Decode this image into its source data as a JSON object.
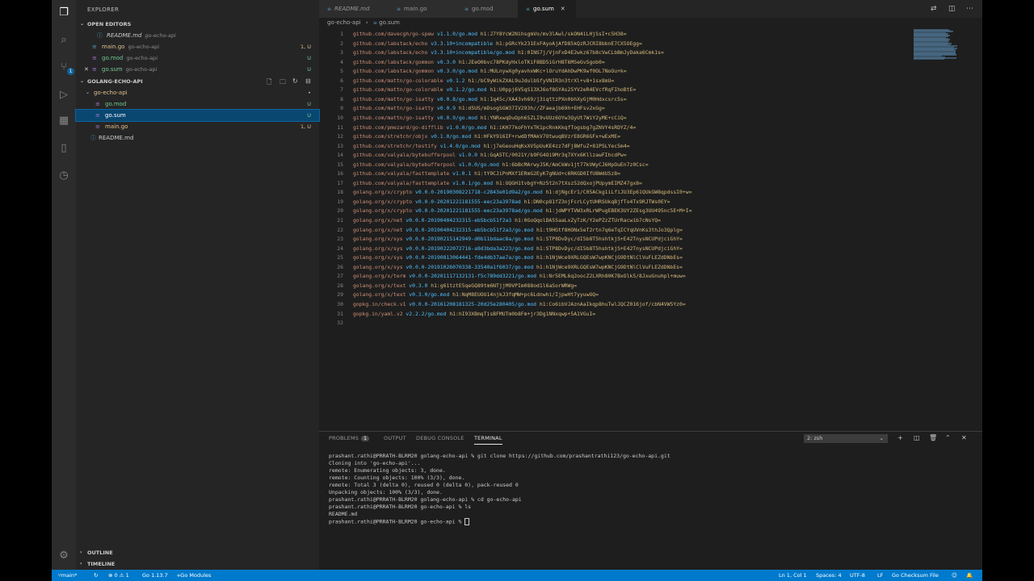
{
  "colors": {
    "accent": "#007acc",
    "modified": "#e2c08d",
    "untracked": "#73c991"
  },
  "activity": [
    "files-icon",
    "search-icon",
    "source-control-icon",
    "run-debug-icon",
    "extensions-icon",
    "bookmark-icon",
    "git-graph-icon",
    "settings-icon"
  ],
  "scm_badge": "1",
  "sidebar": {
    "title": "EXPLORER",
    "open_editors_label": "OPEN EDITORS",
    "open_editors": [
      {
        "name": "README.md",
        "sub": "go-echo-api",
        "status": "",
        "cls": "plain",
        "icon": "info-icon"
      },
      {
        "name": "main.go",
        "sub": "go-echo-api",
        "status": "1, U",
        "cls": "mod",
        "icon": "go-file-icon"
      },
      {
        "name": "go.mod",
        "sub": "go-echo-api",
        "status": "U",
        "cls": "unt",
        "icon": "go-mod-icon"
      },
      {
        "name": "go.sum",
        "sub": "go-echo-api",
        "status": "U",
        "cls": "unt",
        "icon": "go-sum-icon"
      }
    ],
    "project_label": "GOLANG-ECHO-API",
    "folder": {
      "name": "go-echo-api",
      "status": "•"
    },
    "files": [
      {
        "name": "go.mod",
        "status": "U",
        "cls": "unt",
        "selected": false
      },
      {
        "name": "go.sum",
        "status": "U",
        "cls": "unt",
        "selected": true
      },
      {
        "name": "main.go",
        "status": "1, U",
        "cls": "mod",
        "selected": false
      },
      {
        "name": "README.md",
        "status": "",
        "cls": "plain",
        "selected": false
      }
    ],
    "outline_label": "OUTLINE",
    "timeline_label": "TIMELINE"
  },
  "tabs": [
    {
      "label": "README.md",
      "active": false
    },
    {
      "label": "main.go",
      "active": false
    },
    {
      "label": "go.mod",
      "active": false
    },
    {
      "label": "go.sum",
      "active": true
    }
  ],
  "breadcrumb": [
    "go-echo-api",
    "go.sum"
  ],
  "code_lines": [
    [
      "github.com/davecgh/go-spew",
      "v1.1.0/go.mod",
      "h1:J7Y8YcW2NihsgmVo/mv3lAwl/skON4iLHjSsI+c5H38="
    ],
    [
      "github.com/labstack/echo",
      "v3.3.10+incompatible",
      "h1:pGRcYk231ExFAyoAjAfD85kQzRJCRI8bbnE7CX5OEgg="
    ],
    [
      "github.com/labstack/echo",
      "v3.3.10+incompatible/go.mod",
      "h1:0INS7j/VjnFxD4E2wkz67b8cVwCLbBmJyDaka6Cmk1s="
    ],
    [
      "github.com/labstack/gommon",
      "v0.3.0",
      "h1:JEeO0bvc78PKdyHxloTKiF8BD5iGrH8T6MSeGvSgob0="
    ],
    [
      "github.com/labstack/gommon",
      "v0.3.0/go.mod",
      "h1:MULnywXg0yavhxWKc+lOruYdAhDwPK9wf0OL7NoOu+k="
    ],
    [
      "github.com/mattn/go-colorable",
      "v0.1.2",
      "h1:/bC9yWikZXAL9uJdulbSfyVNIR3n3trXl+v8+1sx8mU="
    ],
    [
      "github.com/mattn/go-colorable",
      "v0.1.2/go.mod",
      "h1:U0ppj6V5qS13XJ6of8GYAs25YV2eR4EVcfRqFIhoBtE="
    ],
    [
      "github.com/mattn/go-isatty",
      "v0.0.8/go.mod",
      "h1:Iq45c/XA43vh69/j3iqttzPXn0bhXyGjM0Hdxcsrc5s="
    ],
    [
      "github.com/mattn/go-isatty",
      "v0.0.9",
      "h1:d5US/mDsogSGW37IV293h//ZFaeajb69h+EHFsv2xGg="
    ],
    [
      "github.com/mattn/go-isatty",
      "v0.0.9/go.mod",
      "h1:YNRxwqDuOph6SZLI9vUUz6OYw3QyUt7WiY2yME+cCiQ="
    ],
    [
      "github.com/pmezard/go-difflib",
      "v1.0.0/go.mod",
      "h1:iKH77koFhYxTK1pcRnkKkqfTogsbg7gZNVY4sRDYZ/4="
    ],
    [
      "github.com/stretchr/objx",
      "v0.1.0/go.mod",
      "h1:HFkY916IF+rwdDfMAkV7OtwuqBVzrE8GR6GFx+wExME="
    ],
    [
      "github.com/stretchr/testify",
      "v1.4.0/go.mod",
      "h1:j7eGeouHqKxXV5pUuKE4zz7dFj8WfuZ+81PSLYec5m4="
    ],
    [
      "github.com/valyala/bytebufferpool",
      "v1.0.0",
      "h1:GqA5TC/0021Y/b9FG4Oi9Mr3q7XYx6KllzawFIhcdPw="
    ],
    [
      "github.com/valyala/bytebufferpool",
      "v1.0.0/go.mod",
      "h1:6bBcMArwyJ5K/AmCkWv1jt77kVWyCJ6HpOuEn7z0Csc="
    ],
    [
      "github.com/valyala/fasttemplate",
      "v1.0.1",
      "h1:tY9CJiPnMXf1ERmG2EyK7gNUd+c6RKGD0IfU8WdUSz8="
    ],
    [
      "github.com/valyala/fasttemplate",
      "v1.0.1/go.mod",
      "h1:UQGH1tvbgY+Nz5t2n7tXsz52dQxojPUpymEIMZ47gx8="
    ],
    [
      "golang.org/x/crypto",
      "v0.0.0-20190308221718-c2843e01d9a2/go.mod",
      "h1:djNgcEr1/C05ACkg1iLfiJU3Ep61QUkGW8qpdssI0+w="
    ],
    [
      "golang.org/x/crypto",
      "v0.0.0-20201221181555-eec23a3978ad",
      "h1:DN0cp81fZ3njFcrLCytUHRSUkqBjfTo4Tx9RJTWs0EY="
    ],
    [
      "golang.org/x/crypto",
      "v0.0.0-20201221181555-eec23a3978ad/go.mod",
      "h1:jdWPYTVW3xRLrWPugEBEK3UY2ZEsg3UU495nc5E+M+I="
    ],
    [
      "golang.org/x/net",
      "v0.0.0-20190404232315-eb5bcb51f2a3",
      "h1:0GoQqolDA55aaLxZyTzK/Y2ePZzZTUrRacwib7cNsYQ="
    ],
    [
      "golang.org/x/net",
      "v0.0.0-20190404232315-eb5bcb51f2a3/go.mod",
      "h1:t9HGtf8HONx5eT2rtn7q6eTqICYqUVnKs3thJo3Qplg="
    ],
    [
      "golang.org/x/sys",
      "v0.0.0-20190215142949-d0b11bdaac8a/go.mod",
      "h1:STP8DvDyc/dI5b8T5hshtkjS+E42TnysNCUPdjciGhY="
    ],
    [
      "golang.org/x/sys",
      "v0.0.0-20190222072716-a9d3bda3a223/go.mod",
      "h1:STP8DvDyc/dI5b8T5hshtkjS+E42TnysNCUPdjciGhY="
    ],
    [
      "golang.org/x/sys",
      "v0.0.0-20190813064441-fde4db37ae7a/go.mod",
      "h1:h1NjWce9XRLGQEsW7wpKNCjG9DtNlClVuFLEZdDNbEs="
    ],
    [
      "golang.org/x/sys",
      "v0.0.0-20191026070338-33540a1f6037/go.mod",
      "h1:h1NjWce9XRLGQEsW7wpKNCjG9DtNlClVuFLEZdDNbEs="
    ],
    [
      "golang.org/x/term",
      "v0.0.0-20201117132131-f5c789dd3221/go.mod",
      "h1:Nr5EML6q2oocZ2LXRh80K7BxOlk5/8JxuGnuhpl+muw="
    ],
    [
      "golang.org/x/text",
      "v0.3.0",
      "h1:g61tztE5qeGQ89tm6NTjjM9VPIm088od1l6aSorWRWg="
    ],
    [
      "golang.org/x/text",
      "v0.3.0/go.mod",
      "h1:NqM8EUOU14njkJ3fqMW+pc6Ldnwhi/IjpwHt7yyuwOQ="
    ],
    [
      "gopkg.in/check.v1",
      "v0.0.0-20161208181325-20d25e280405/go.mod",
      "h1:Co6ibVJAznAaIkqp8huTwlJQCZ016jof/cbN4VW5Yz0="
    ],
    [
      "gopkg.in/yaml.v2",
      "v2.2.2/go.mod",
      "h1:hI93XBmqTisBFMUTm0b8Fm+jr3Dg1NNxqwp+5A1VGuI="
    ],
    [
      "",
      "",
      ""
    ]
  ],
  "panel": {
    "tabs": [
      {
        "label": "PROBLEMS",
        "badge": "1",
        "active": false
      },
      {
        "label": "OUTPUT",
        "badge": "",
        "active": false
      },
      {
        "label": "DEBUG CONSOLE",
        "badge": "",
        "active": false
      },
      {
        "label": "TERMINAL",
        "badge": "",
        "active": true
      }
    ],
    "terminal_select": "2: zsh",
    "terminal_lines": [
      "prashant.rathi@PRRATH-BLRM20 golang-echo-api % git clone https://github.com/prashantrathi123/go-echo-api.git",
      "Cloning into 'go-echo-api'...",
      "remote: Enumerating objects: 3, done.",
      "remote: Counting objects: 100% (3/3), done.",
      "remote: Total 3 (delta 0), reused 0 (delta 0), pack-reused 0",
      "Unpacking objects: 100% (3/3), done.",
      "prashant.rathi@PRRATH-BLRM20 golang-echo-api % cd go-echo-api",
      "prashant.rathi@PRRATH-BLRM20 go-echo-api % ls",
      "README.md",
      "prashant.rathi@PRRATH-BLRM20 go-echo-api % "
    ]
  },
  "status": {
    "branch": "main*",
    "problems": "⊗ 0 ⚠ 1",
    "go_version": "Go 1.13.7",
    "go_modules": "Go Modules",
    "position": "Ln 1, Col 1",
    "spaces": "Spaces: 4",
    "encoding": "UTF-8",
    "eol": "LF",
    "language": "Go Checksum File"
  }
}
